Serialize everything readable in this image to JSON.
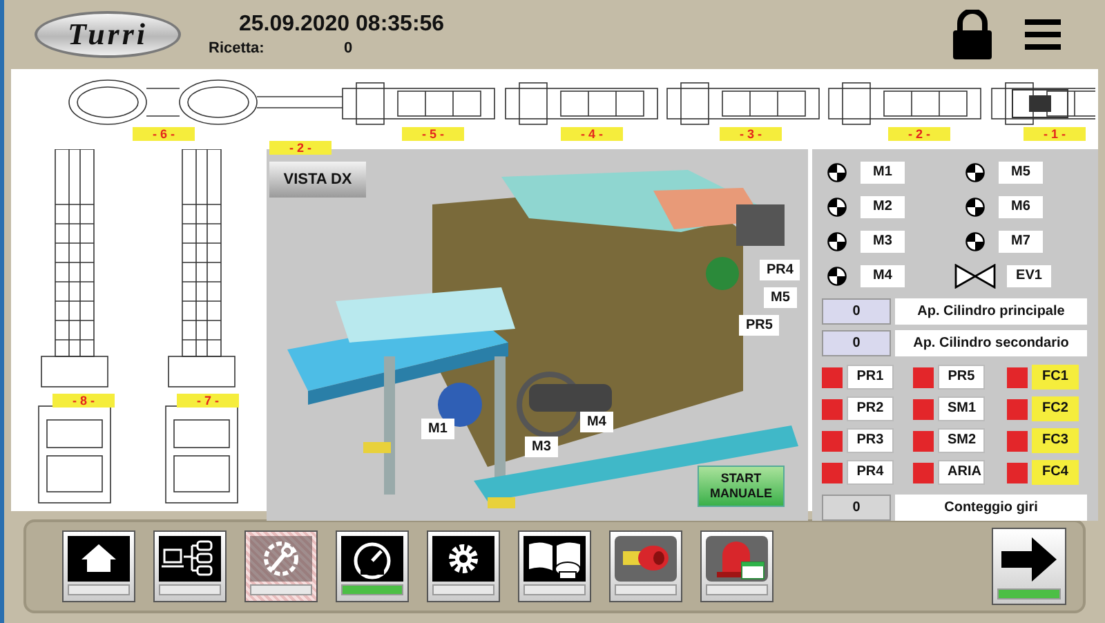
{
  "header": {
    "logo": "Turri",
    "datetime": "25.09.2020 08:35:56",
    "recipe_label": "Ricetta:",
    "recipe_value": "0"
  },
  "line_labels": [
    {
      "text": "- 6 -"
    },
    {
      "text": "- 5 -"
    },
    {
      "text": "- 4 -"
    },
    {
      "text": "- 3 -"
    },
    {
      "text": "- 2 -"
    },
    {
      "text": "- 1 -"
    }
  ],
  "elevator_labels": [
    {
      "text": "- 8 -"
    },
    {
      "text": "- 7 -"
    }
  ],
  "main_view": {
    "title": "- 2 -",
    "view_button": "VISTA DX",
    "callouts": [
      {
        "text": "PR4"
      },
      {
        "text": "M5"
      },
      {
        "text": "PR5"
      },
      {
        "text": "M1"
      },
      {
        "text": "M4"
      },
      {
        "text": "M3"
      }
    ],
    "start_button": "START MANUALE"
  },
  "motors": [
    {
      "label": "M1"
    },
    {
      "label": "M2"
    },
    {
      "label": "M3"
    },
    {
      "label": "M4"
    },
    {
      "label": "M5"
    },
    {
      "label": "M6"
    },
    {
      "label": "M7"
    }
  ],
  "valve": {
    "label": "EV1"
  },
  "cylinders": [
    {
      "value": "0",
      "label": "Ap. Cilindro principale"
    },
    {
      "value": "0",
      "label": "Ap. Cilindro secondario"
    }
  ],
  "sensors": [
    {
      "label": "PR1",
      "kind": "sensor",
      "alarm": true
    },
    {
      "label": "PR5",
      "kind": "sensor",
      "alarm": true
    },
    {
      "label": "FC1",
      "kind": "limit",
      "alarm": true
    },
    {
      "label": "PR2",
      "kind": "sensor",
      "alarm": true
    },
    {
      "label": "SM1",
      "kind": "sensor",
      "alarm": true
    },
    {
      "label": "FC2",
      "kind": "limit",
      "alarm": true
    },
    {
      "label": "PR3",
      "kind": "sensor",
      "alarm": true
    },
    {
      "label": "SM2",
      "kind": "sensor",
      "alarm": true
    },
    {
      "label": "FC3",
      "kind": "limit",
      "alarm": true
    },
    {
      "label": "PR4",
      "kind": "sensor",
      "alarm": true
    },
    {
      "label": "ARIA",
      "kind": "sensor",
      "alarm": true
    },
    {
      "label": "FC4",
      "kind": "limit",
      "alarm": true
    }
  ],
  "counter": {
    "value": "0",
    "label": "Conteggio giri"
  },
  "toolbar": [
    {
      "active": false,
      "disabled": false
    },
    {
      "active": false,
      "disabled": false
    },
    {
      "active": false,
      "disabled": true
    },
    {
      "active": true,
      "disabled": false
    },
    {
      "active": false,
      "disabled": false
    },
    {
      "active": false,
      "disabled": false
    },
    {
      "active": false,
      "disabled": false
    },
    {
      "active": false,
      "disabled": false
    }
  ],
  "next_button": {
    "active": true
  }
}
